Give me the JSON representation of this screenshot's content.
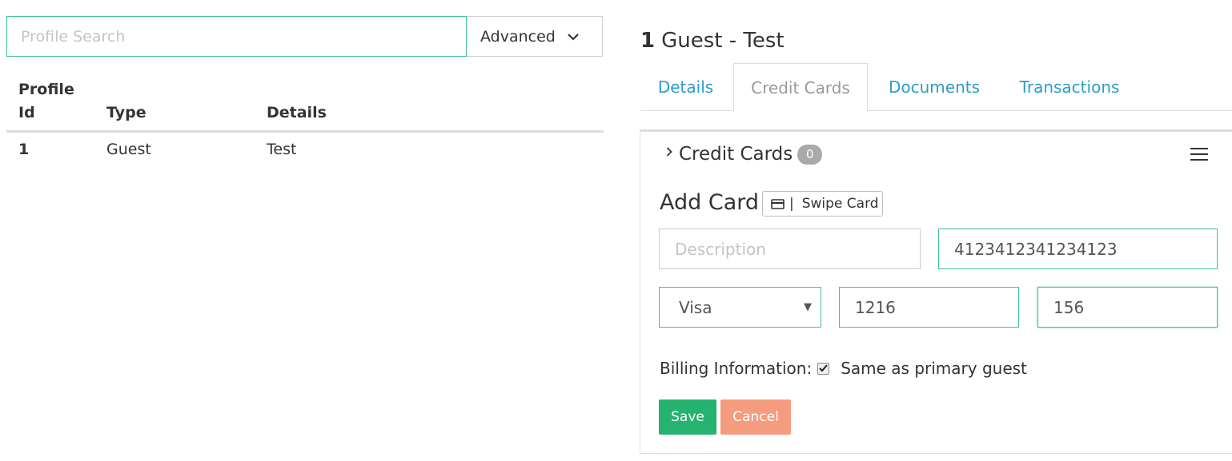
{
  "search": {
    "placeholder": "Profile Search",
    "value": "",
    "advanced_label": "Advanced"
  },
  "results": {
    "columns": [
      "Profile Id",
      "Type",
      "Details"
    ],
    "column_lines": [
      [
        "Profile",
        "Id"
      ],
      [
        "Type"
      ],
      [
        "Details"
      ]
    ],
    "rows": [
      {
        "id": "1",
        "type": "Guest",
        "details": "Test"
      }
    ]
  },
  "profile": {
    "id": "1",
    "name": "Guest - Test"
  },
  "tabs": [
    {
      "label": "Details",
      "active": false
    },
    {
      "label": "Credit Cards",
      "active": true
    },
    {
      "label": "Documents",
      "active": false
    },
    {
      "label": "Transactions",
      "active": false
    }
  ],
  "credit_cards": {
    "section_label": "Credit Cards",
    "count": "0",
    "add_card_title": "Add Card",
    "swipe_label": "Swipe Card",
    "swipe_sep": "|",
    "description_placeholder": "Description",
    "description_value": "",
    "card_number": "4123412341234123",
    "card_type_selected": "Visa",
    "expiry": "1216",
    "cvv": "156",
    "billing_label": "Billing Information:",
    "billing_checked": true,
    "same_as_primary_label": "Same as primary guest",
    "save_label": "Save",
    "cancel_label": "Cancel"
  },
  "colors": {
    "accent_green": "#3fbf9a",
    "tab_link": "#2b9ec7",
    "save_button": "#26b26f",
    "cancel_button": "#f59b7e",
    "badge": "#aaaaaa"
  },
  "icons": [
    "chevron-down-icon",
    "chevron-right-icon",
    "hamburger-menu-icon",
    "credit-card-icon",
    "checkmark-icon"
  ]
}
